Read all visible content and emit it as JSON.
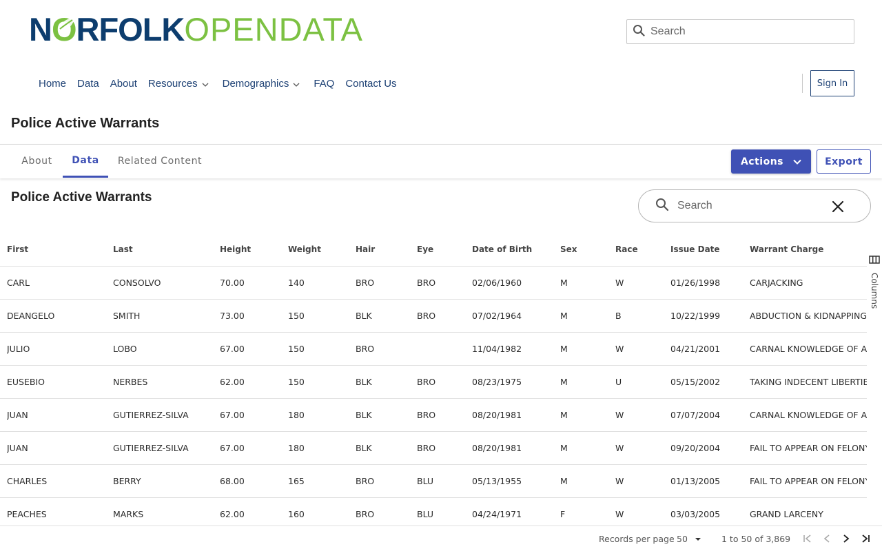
{
  "header": {
    "logo": {
      "part1": "N",
      "part2": "RFOLK",
      "part3": "OPENDATA"
    },
    "search_placeholder": "Search"
  },
  "nav": {
    "items": [
      {
        "label": "Home"
      },
      {
        "label": "Data"
      },
      {
        "label": "About"
      },
      {
        "label": "Resources",
        "dropdown": true
      },
      {
        "label": "Demographics",
        "dropdown": true
      },
      {
        "label": "FAQ"
      },
      {
        "label": "Contact Us"
      }
    ],
    "sign_in": "Sign In"
  },
  "page_title": "Police Active Warrants",
  "tabs": [
    {
      "label": "About",
      "active": false
    },
    {
      "label": "Data",
      "active": true
    },
    {
      "label": "Related Content",
      "active": false
    }
  ],
  "toolbar": {
    "actions_label": "Actions",
    "export_label": "Export"
  },
  "dataset": {
    "title": "Police Active Warrants",
    "search_placeholder": "Search",
    "columns_label": "Columns"
  },
  "table": {
    "headers": [
      "First",
      "Last",
      "Height",
      "Weight",
      "Hair",
      "Eye",
      "Date of Birth",
      "Sex",
      "Race",
      "Issue Date",
      "Warrant Charge"
    ],
    "rows": [
      [
        "CARL",
        "CONSOLVO",
        "70.00",
        "140",
        "BRO",
        "BRO",
        "02/06/1960",
        "M",
        "W",
        "01/26/1998",
        "CARJACKING"
      ],
      [
        "DEANGELO",
        "SMITH",
        "73.00",
        "150",
        "BLK",
        "BRO",
        "07/02/1964",
        "M",
        "B",
        "10/22/1999",
        "ABDUCTION & KIDNAPPING"
      ],
      [
        "JULIO",
        "LOBO",
        "67.00",
        "150",
        "BRO",
        "",
        "11/04/1982",
        "M",
        "W",
        "04/21/2001",
        "CARNAL KNOWLEDGE OF A C"
      ],
      [
        "EUSEBIO",
        "NERBES",
        "62.00",
        "150",
        "BLK",
        "BRO",
        "08/23/1975",
        "M",
        "U",
        "05/15/2002",
        "TAKING INDECENT LIBERTIE"
      ],
      [
        "JUAN",
        "GUTIERREZ-SILVA",
        "67.00",
        "180",
        "BLK",
        "BRO",
        "08/20/1981",
        "M",
        "W",
        "07/07/2004",
        "CARNAL KNOWLEDGE OF A C"
      ],
      [
        "JUAN",
        "GUTIERREZ-SILVA",
        "67.00",
        "180",
        "BLK",
        "BRO",
        "08/20/1981",
        "M",
        "W",
        "09/20/2004",
        "FAIL TO APPEAR ON FELONY"
      ],
      [
        "CHARLES",
        "BERRY",
        "68.00",
        "165",
        "BRO",
        "BLU",
        "05/13/1955",
        "M",
        "W",
        "01/13/2005",
        "FAIL TO APPEAR ON FELONY"
      ],
      [
        "PEACHES",
        "MARKS",
        "62.00",
        "160",
        "BRO",
        "BLU",
        "04/24/1971",
        "F",
        "W",
        "03/03/2005",
        "GRAND LARCENY"
      ]
    ]
  },
  "pager": {
    "records_per_page_label": "Records per page",
    "page_size": "50",
    "range": "1 to 50 of 3,869"
  },
  "colors": {
    "brand_navy": "#0d3d6e",
    "brand_green": "#7cc142",
    "accent": "#3f51b5"
  }
}
